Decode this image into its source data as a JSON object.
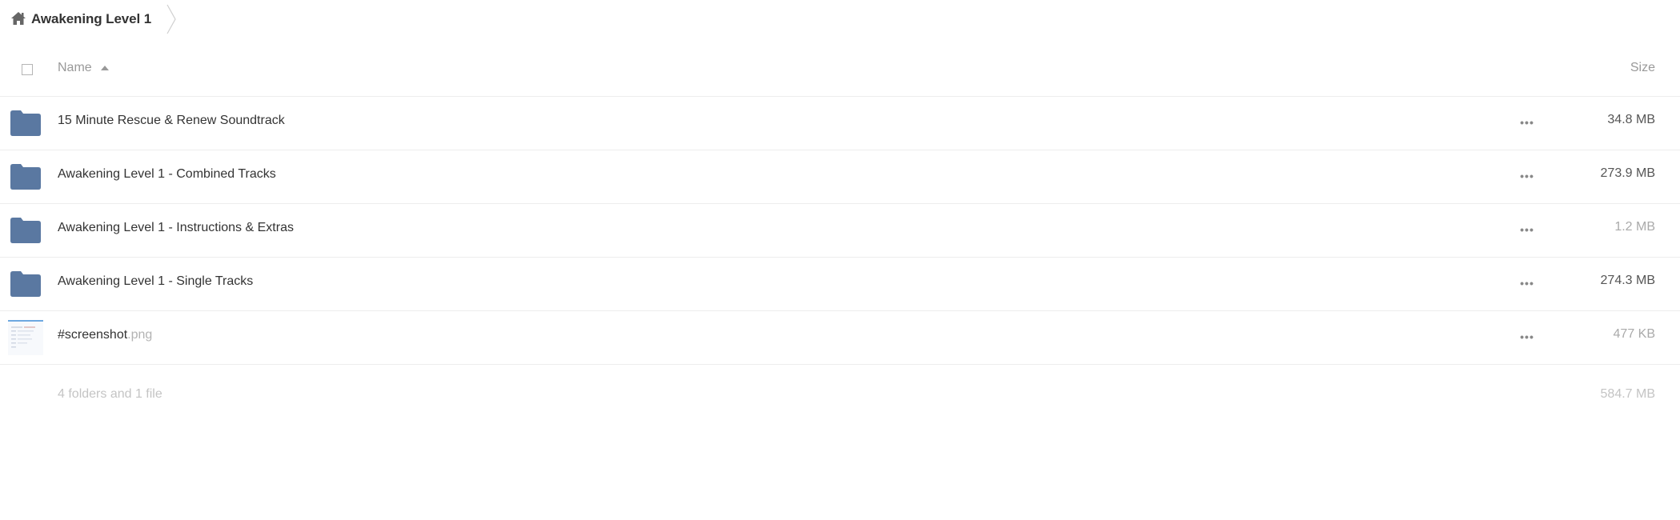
{
  "breadcrumb": {
    "home_icon": "home-icon",
    "current": "Awakening Level 1"
  },
  "table": {
    "columns": {
      "name": "Name",
      "size": "Size",
      "sort": "ascending"
    },
    "rows": [
      {
        "type": "folder",
        "icon": "folder-icon",
        "name": "15 Minute Rescue & Renew Soundtrack",
        "ext": "",
        "size": "34.8 MB"
      },
      {
        "type": "folder",
        "icon": "folder-icon",
        "name": "Awakening Level 1 - Combined Tracks",
        "ext": "",
        "size": "273.9 MB"
      },
      {
        "type": "folder",
        "icon": "folder-icon",
        "name": "Awakening Level 1 - Instructions & Extras",
        "ext": "",
        "size": "1.2 MB"
      },
      {
        "type": "folder",
        "icon": "folder-icon",
        "name": "Awakening Level 1 - Single Tracks",
        "ext": "",
        "size": "274.3 MB"
      },
      {
        "type": "file",
        "icon": "image-thumbnail-icon",
        "name": "#screenshot",
        "ext": ".png",
        "size": "477 KB"
      }
    ],
    "summary": {
      "text": "4 folders and 1 file",
      "size": "584.7 MB"
    }
  },
  "colors": {
    "folder": "#5a78a1",
    "border": "#ededed",
    "muted_text": "#999999"
  }
}
